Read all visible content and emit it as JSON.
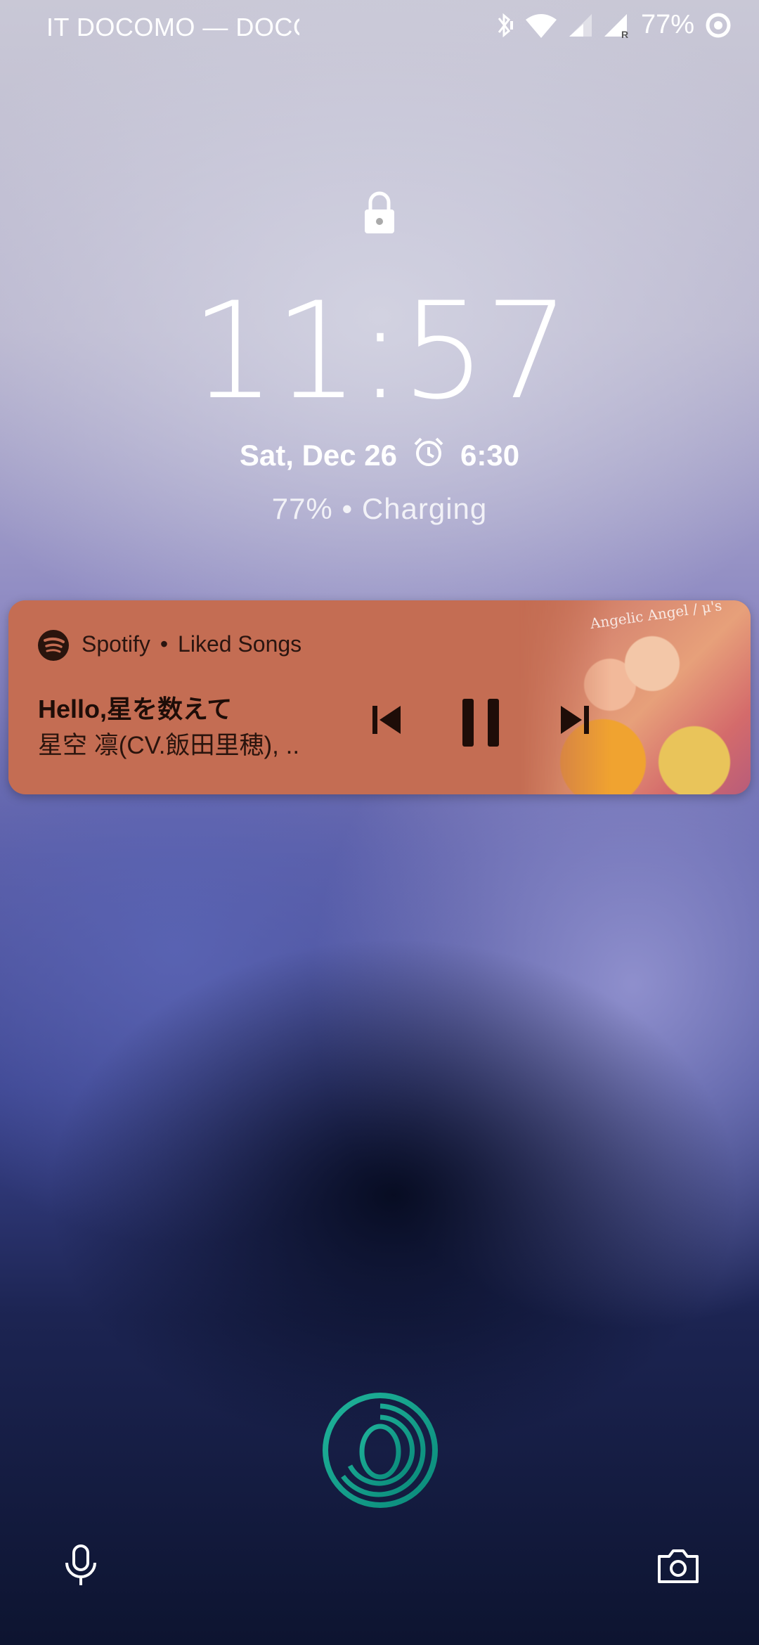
{
  "status_bar": {
    "carrier": "IT DOCOMO — DOCC",
    "battery_percent": "77%",
    "icons": [
      "bluetooth-icon",
      "wifi-icon",
      "signal-icon",
      "signal-roaming-icon",
      "battery-saver-icon"
    ]
  },
  "lockscreen": {
    "time": "11:57",
    "date": "Sat, Dec 26",
    "alarm_time": "6:30",
    "charging_status": "77% • Charging"
  },
  "notification": {
    "app_name": "Spotify",
    "separator": "•",
    "context": "Liked Songs",
    "title": "Hello,星を数えて",
    "artist": "星空 凛(CV.飯田里穂), ..",
    "album_art_caption": "Angelic Angel / μ's",
    "accent_color": "#c46d53",
    "controls": [
      "previous-icon",
      "pause-icon",
      "next-icon"
    ]
  },
  "bottom_actions": [
    "voice-assistant-icon",
    "fingerprint-icon",
    "camera-icon"
  ]
}
